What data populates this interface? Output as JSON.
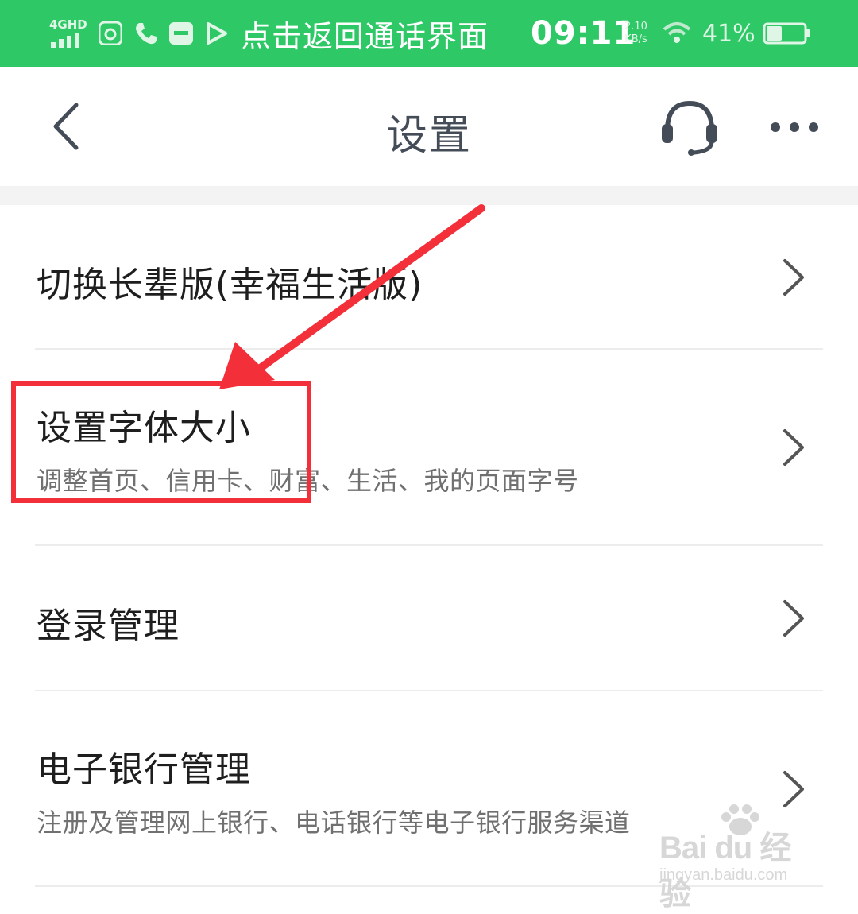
{
  "status_bar": {
    "network": "4GHD",
    "call_banner": "点击返回通话界面",
    "time": "09:11",
    "net_speed_value": "2.10",
    "net_speed_unit": "KB/s",
    "battery": "41%",
    "battery_level": 0.41,
    "bg_color": "#2ec866"
  },
  "header": {
    "title": "设置",
    "back_icon": "chevron-left-icon",
    "service_icon": "headset-icon",
    "more_icon": "more-dots-icon"
  },
  "settings": [
    {
      "title": "切换长辈版(幸福生活版)",
      "subtitle": ""
    },
    {
      "title": "设置字体大小",
      "subtitle": "调整首页、信用卡、财富、生活、我的页面字号"
    },
    {
      "title": "登录管理",
      "subtitle": ""
    },
    {
      "title": "电子银行管理",
      "subtitle": "注册及管理网上银行、电话银行等电子银行服务渠道"
    }
  ],
  "annotation": {
    "color": "#f3303a"
  },
  "watermark": {
    "logo": "Bai du 经验",
    "url": "jingyan.baidu.com"
  }
}
